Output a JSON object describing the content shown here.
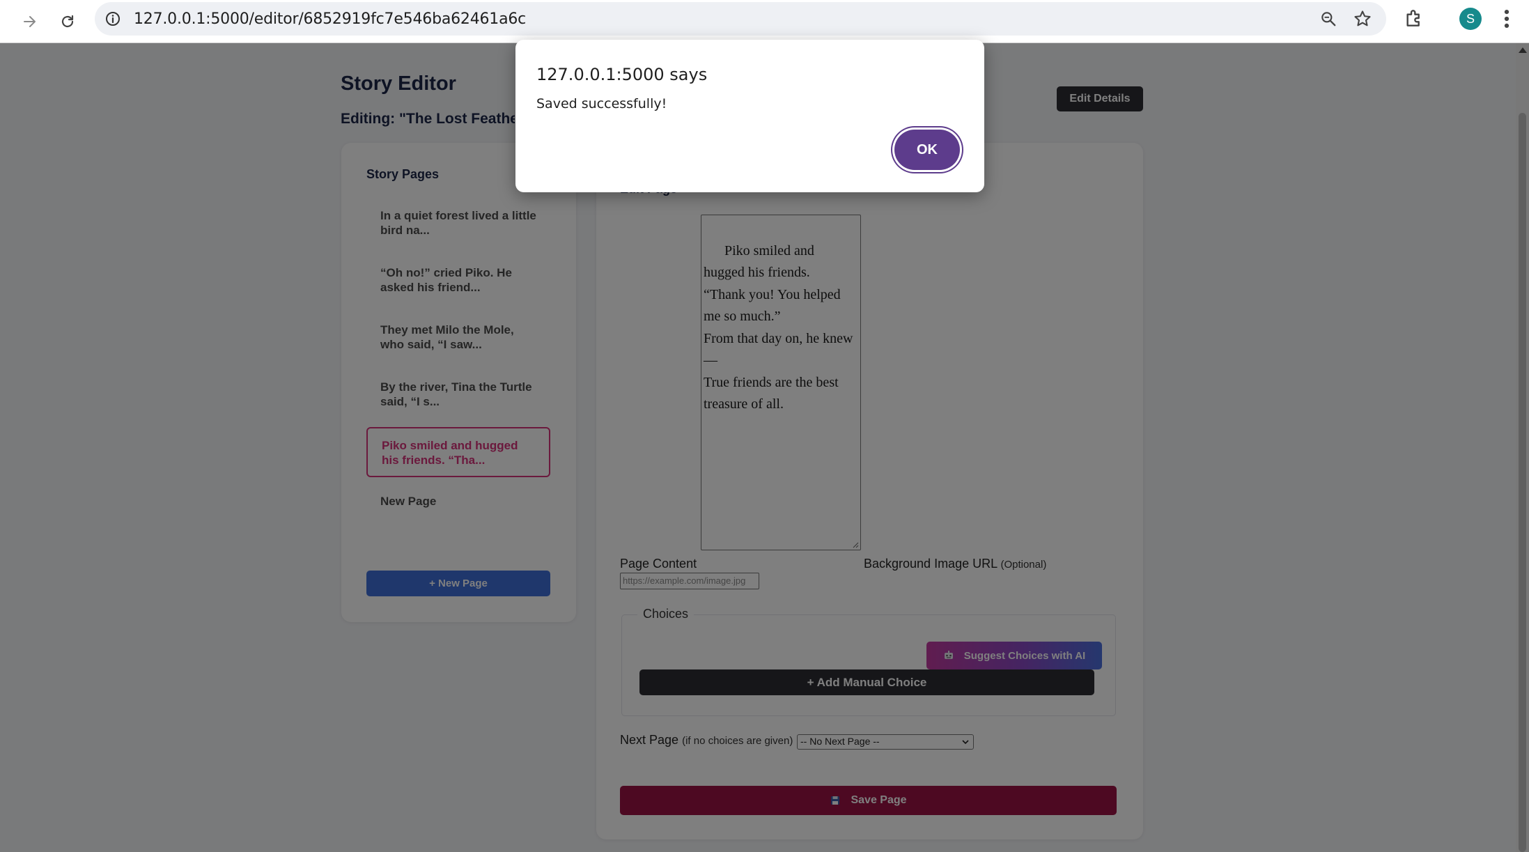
{
  "browser": {
    "url": "127.0.0.1:5000/editor/6852919fc7e546ba62461a6c",
    "avatar_letter": "S",
    "avatar_color": "#168a8c"
  },
  "header": {
    "title": "Story Editor",
    "editing": "Editing: \"The Lost Feather\"",
    "edit_details_label": "Edit Details"
  },
  "sidebar": {
    "title": "Story Pages",
    "items": [
      {
        "label": "In a quiet forest lived a little bird na..."
      },
      {
        "label": "“Oh no!” cried Piko. He asked his friend..."
      },
      {
        "label": "They met Milo the Mole, who said, “I saw..."
      },
      {
        "label": "By the river, Tina the Turtle said, “I s..."
      },
      {
        "label": "Piko smiled and hugged his friends. “Tha..."
      },
      {
        "label": "New Page"
      }
    ],
    "active_index": 4,
    "new_page_label": "+ New Page"
  },
  "editor": {
    "heading": "Edit Page",
    "content": "Piko smiled and hugged his friends.\n“Thank you! You helped me so much.”\nFrom that day on, he knew—\nTrue friends are the best treasure of all.",
    "content_label": "Page Content",
    "bg_label": "Background Image URL",
    "bg_optional": "(Optional)",
    "bg_placeholder": "https://example.com/image.jpg",
    "choices_legend": "Choices",
    "suggest_label": "Suggest Choices with AI",
    "manual_label": "+ Add Manual Choice",
    "next_label": "Next Page",
    "next_hint": "(if no choices are given)",
    "next_selected": "-- No Next Page --",
    "save_label": "Save Page"
  },
  "dialog": {
    "title": "127.0.0.1:5000 says",
    "message": "Saved successfully!",
    "ok_label": "OK"
  },
  "colors": {
    "accent_pink": "#d6337a",
    "new_page_blue": "#3e6fd8",
    "save_red": "#9a1244",
    "ok_purple": "#5d3c8c"
  }
}
